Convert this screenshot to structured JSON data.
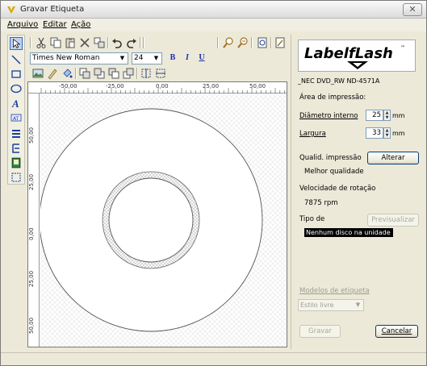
{
  "window": {
    "title": "Gravar Etiqueta",
    "close_glyph": "✕"
  },
  "menu": {
    "items": [
      "Arquivo",
      "Editar",
      "Ação"
    ]
  },
  "toolbar": {
    "font_family": "Times New Roman",
    "font_size": "24",
    "bold_label": "B",
    "italic_label": "I",
    "underline_label": "U"
  },
  "rulers": {
    "horizontal": [
      "-50,00",
      "-25,00",
      "0,00",
      "25,00",
      "50,00"
    ],
    "vertical": [
      "50,00",
      "25,00",
      "0,00",
      "25,00",
      "50,00"
    ]
  },
  "panel": {
    "logo_text": "LabelfLash",
    "logo_tm": "™",
    "drive": "_NEC DVD_RW ND-4571A",
    "print_area_label": "Área de impressão:",
    "inner_diameter_label": "Diâmetro interno",
    "inner_diameter_value": "25",
    "width_label": "Largura",
    "width_value": "33",
    "unit": "mm",
    "quality_label": "Qualid. impressão",
    "change_button": "Alterar",
    "quality_value": "Melhor qualidade",
    "rotation_label": "Velocidade de rotação",
    "rotation_value": "7875 rpm",
    "type_label": "Tipo de",
    "preview_button": "Previsualizar",
    "disc_status": "Nenhum disco na unidade",
    "models_label": "Modelos de etiqueta",
    "style_value": "Estilo livre",
    "write_button": "Gravar",
    "cancel_button": "Cancelar"
  },
  "colors": {
    "accent": "#316ac5",
    "window_bg": "#ece9d8"
  }
}
